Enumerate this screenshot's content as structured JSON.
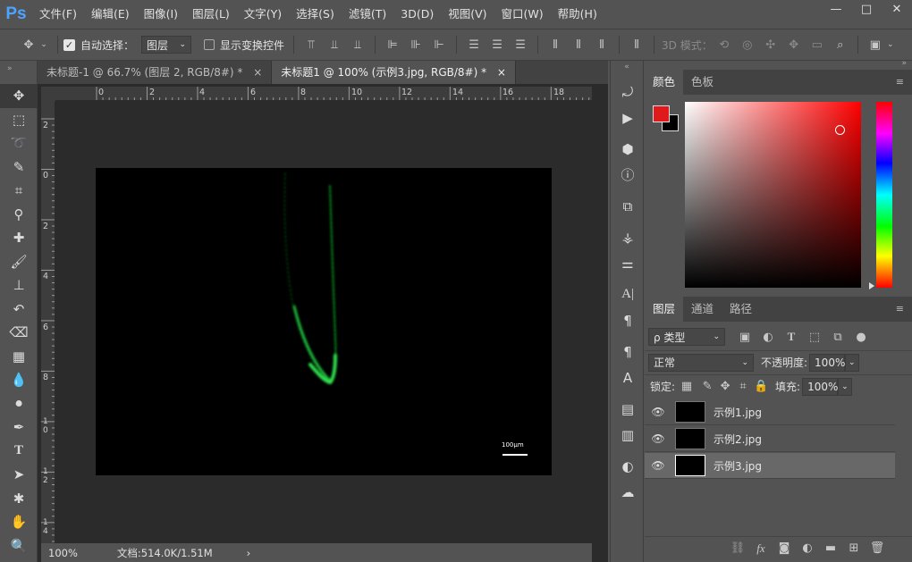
{
  "app": {
    "logo": "Ps"
  },
  "menu": [
    "文件(F)",
    "编辑(E)",
    "图像(I)",
    "图层(L)",
    "文字(Y)",
    "选择(S)",
    "滤镜(T)",
    "3D(D)",
    "视图(V)",
    "窗口(W)",
    "帮助(H)"
  ],
  "window_controls": {
    "minimize": "—",
    "maximize": "□",
    "close": "✕"
  },
  "options": {
    "auto_select_label": "自动选择：",
    "auto_select_value": "图层",
    "show_transform_label": "显示变换控件",
    "mode_3d_label": "3D 模式："
  },
  "tabs": [
    {
      "label": "未标题-1 @ 66.7% (图层 2, RGB/8#) *",
      "close": "×"
    },
    {
      "label": "未标题1 @ 100% (示例3.jpg, RGB/8#) *",
      "close": "×"
    }
  ],
  "ruler_h": [
    "0",
    "2",
    "4",
    "6",
    "8",
    "10",
    "12",
    "14",
    "16",
    "18"
  ],
  "ruler_v": [
    "2",
    "0",
    "2",
    "4",
    "6",
    "8",
    "1\n0",
    "1\n2",
    "1\n4"
  ],
  "image": {
    "scale_label": "100μm"
  },
  "status": {
    "zoom": "100%",
    "doc": "文档:514.0K/1.51M",
    "arrow": "›"
  },
  "color_panel": {
    "tabs": [
      "颜色",
      "色板"
    ],
    "fg_color": "#e01a1a",
    "bg_color": "#000000"
  },
  "layers_panel": {
    "tabs": [
      "图层",
      "通道",
      "路径"
    ],
    "filter_label": "ρ 类型",
    "blend_mode": "正常",
    "opacity_label": "不透明度:",
    "opacity_value": "100%",
    "lock_label": "锁定:",
    "fill_label": "填充:",
    "fill_value": "100%",
    "layers": [
      {
        "name": "示例1.jpg",
        "selected": false
      },
      {
        "name": "示例2.jpg",
        "selected": false
      },
      {
        "name": "示例3.jpg",
        "selected": true
      }
    ],
    "bottom_fx": "fx"
  }
}
